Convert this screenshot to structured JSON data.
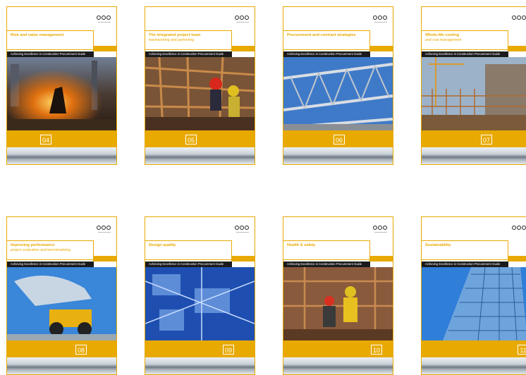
{
  "covers": [
    {
      "title": "Risk and value management",
      "subtitle": "",
      "series": "Achieving Excellence in Construction Procurement Guide",
      "number": "04",
      "side_mark": ""
    },
    {
      "title": "The integrated project team",
      "subtitle": "teamworking and partnering",
      "series": "Achieving Excellence in Construction Procurement Guide",
      "number": "05",
      "side_mark": ""
    },
    {
      "title": "Procurement and contract strategies",
      "subtitle": "",
      "series": "Achieving Excellence in Construction Procurement Guide",
      "number": "06",
      "side_mark": ""
    },
    {
      "title": "Whole-life costing",
      "subtitle": "and cost management",
      "series": "Achieving Excellence in Construction Procurement Guide",
      "number": "07",
      "side_mark": ""
    },
    {
      "title": "Improving performance",
      "subtitle": "project evaluation and benchmarking",
      "series": "Achieving Excellence in Construction Procurement Guide",
      "number": "08",
      "side_mark": ""
    },
    {
      "title": "Design quality",
      "subtitle": "",
      "series": "Achieving Excellence in Construction Procurement Guide",
      "number": "09",
      "side_mark": ""
    },
    {
      "title": "Health & safety",
      "subtitle": "",
      "series": "Achieving Excellence in Construction Procurement Guide",
      "number": "10",
      "side_mark": ""
    },
    {
      "title": "Sustainability",
      "subtitle": "",
      "series": "Achieving Excellence in Construction Procurement Guide",
      "number": "11",
      "side_mark": ""
    }
  ],
  "colors": {
    "accent": "#e8a900",
    "series_bar": "#1b1b1b"
  },
  "icons": {
    "logo": "ogc-logo-icon"
  }
}
